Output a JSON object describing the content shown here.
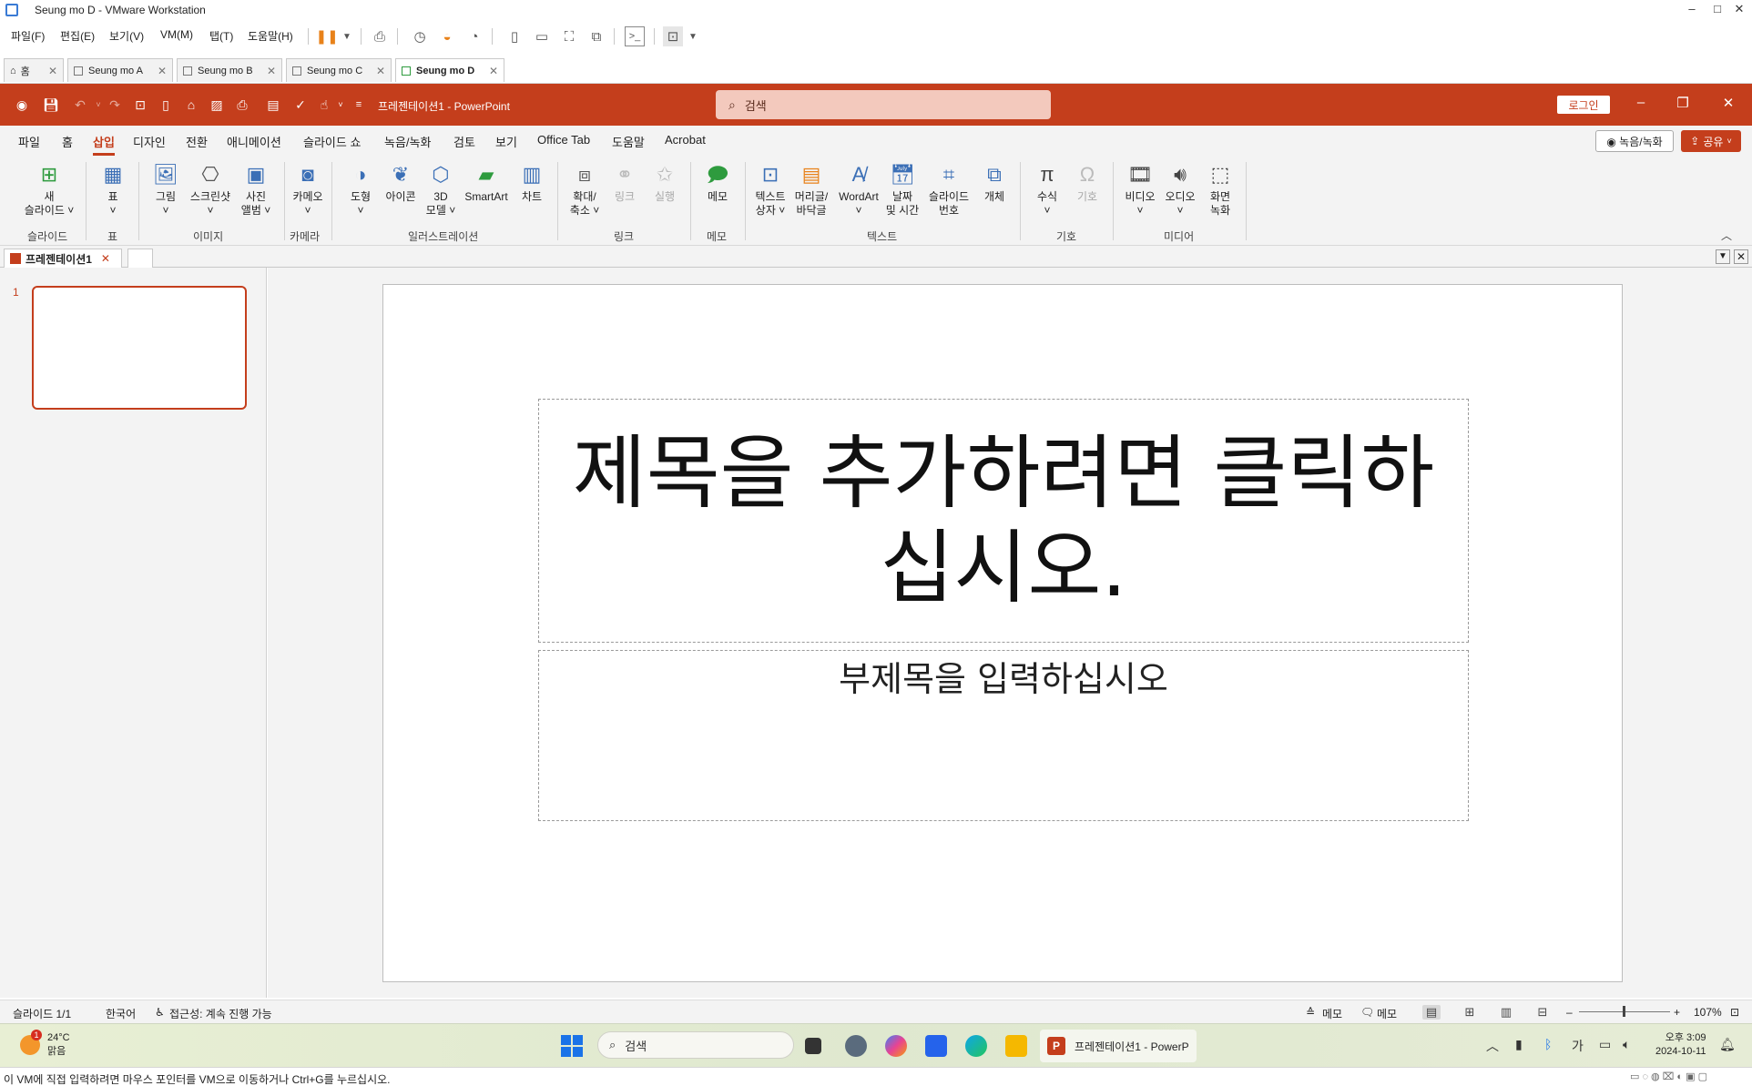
{
  "vm": {
    "title": "Seung mo D - VMware Workstation",
    "menu": [
      "파일(F)",
      "편집(E)",
      "보기(V)",
      "VM(M)",
      "탭(T)",
      "도움말(H)"
    ],
    "tabs": [
      "홈",
      "Seung mo A",
      "Seung mo B",
      "Seung mo C",
      "Seung mo D"
    ],
    "status_text": "이 VM에 직접 입력하려면 마우스 포인터를 VM으로 이동하거나 Ctrl+G를 누르십시오."
  },
  "ppt": {
    "doc_title": "프레젠테이션1  -  PowerPoint",
    "search_placeholder": "검색",
    "login": "로그인",
    "ribbon_tabs": [
      "파일",
      "홈",
      "삽입",
      "디자인",
      "전환",
      "애니메이션",
      "슬라이드 쇼",
      "녹음/녹화",
      "검토",
      "보기",
      "Office Tab",
      "도움말",
      "Acrobat"
    ],
    "record_btn": "◉ 녹음/녹화",
    "share_btn": "공유",
    "ribbon": {
      "new_slide": [
        "새",
        "슬라이드 ˅"
      ],
      "table": [
        "표",
        "˅"
      ],
      "picture": [
        "그림",
        "˅"
      ],
      "screenshot": [
        "스크린샷",
        "˅"
      ],
      "photo_album": [
        "사진",
        "앨범 ˅"
      ],
      "cameo": [
        "카메오",
        "˅"
      ],
      "shapes": [
        "도형",
        "˅"
      ],
      "icons": [
        "아이콘",
        ""
      ],
      "model3d": [
        "3D",
        "모델 ˅"
      ],
      "smartart": [
        "SmartArt",
        ""
      ],
      "chart": [
        "차트",
        ""
      ],
      "zoom": [
        "확대/",
        "축소 ˅"
      ],
      "link": [
        "링크",
        ""
      ],
      "action": [
        "실행",
        ""
      ],
      "comment": [
        "메모",
        ""
      ],
      "textbox": [
        "텍스트",
        "상자 ˅"
      ],
      "header_footer": [
        "머리글/",
        "바닥글"
      ],
      "wordart": [
        "WordArt",
        "˅"
      ],
      "datetime": [
        "날짜",
        "및 시간"
      ],
      "slide_number": [
        "슬라이드",
        "번호"
      ],
      "object": [
        "개체",
        ""
      ],
      "equation": [
        "수식",
        "˅"
      ],
      "symbol": [
        "기호",
        ""
      ],
      "video": [
        "비디오",
        "˅"
      ],
      "audio": [
        "오디오",
        "˅"
      ],
      "screen_rec": [
        "화면",
        "녹화"
      ],
      "groups": {
        "slides": "슬라이드",
        "tables": "표",
        "images": "이미지",
        "camera": "카메라",
        "illustrations": "일러스트레이션",
        "links": "링크",
        "comments": "메모",
        "text": "텍스트",
        "symbols": "기호",
        "media": "미디어"
      }
    },
    "doc_tab": "프레젠테이션1",
    "thumb_number": "1",
    "slide": {
      "title_placeholder": "제목을 추가하려면 클릭하십시오.",
      "subtitle_placeholder": "부제목을 입력하십시오"
    },
    "status": {
      "slide_count": "슬라이드 1/1",
      "language": "한국어",
      "accessibility": "접근성: 계속 진행 가능",
      "notes": "메모",
      "comments": "메모",
      "zoom": "107%"
    }
  },
  "taskbar": {
    "weather_temp": "24°C",
    "weather_desc": "맑음",
    "weather_badge": "1",
    "search": "검색",
    "ppt_item": "프레젠테이션1 - PowerP",
    "ime": "가",
    "time": "오후 3:09",
    "date": "2024-10-11"
  },
  "colors": {
    "accent": "#c43e1c",
    "ribbon_bg": "#f3f3f3"
  }
}
